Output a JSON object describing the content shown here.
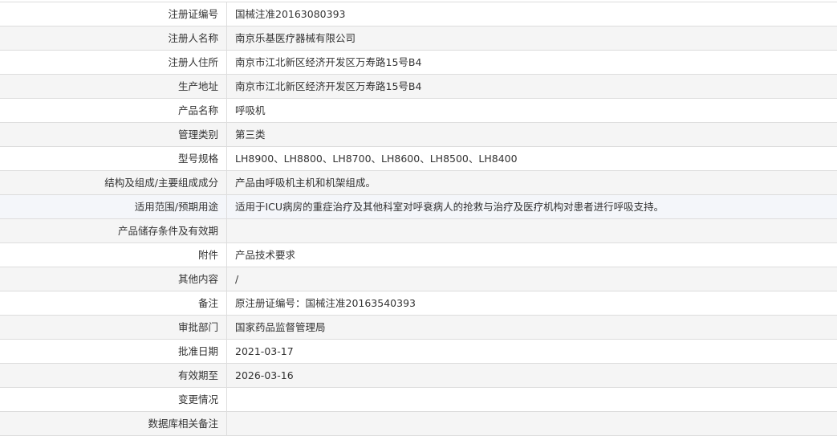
{
  "rows": [
    {
      "label": "注册证编号",
      "value": "国械注准20163080393"
    },
    {
      "label": "注册人名称",
      "value": "南京乐基医疗器械有限公司"
    },
    {
      "label": "注册人住所",
      "value": "南京市江北新区经济开发区万寿路15号B4"
    },
    {
      "label": "生产地址",
      "value": "南京市江北新区经济开发区万寿路15号B4"
    },
    {
      "label": "产品名称",
      "value": "呼吸机"
    },
    {
      "label": "管理类别",
      "value": "第三类"
    },
    {
      "label": "型号规格",
      "value": "LH8900、LH8800、LH8700、LH8600、LH8500、LH8400"
    },
    {
      "label": "结构及组成/主要组成成分",
      "value": "产品由呼吸机主机和机架组成。"
    },
    {
      "label": "适用范围/预期用途",
      "value": "适用于ICU病房的重症治疗及其他科室对呼衰病人的抢救与治疗及医疗机构对患者进行呼吸支持。"
    },
    {
      "label": "产品储存条件及有效期",
      "value": ""
    },
    {
      "label": "附件",
      "value": "产品技术要求"
    },
    {
      "label": "其他内容",
      "value": "/"
    },
    {
      "label": "备注",
      "value": "原注册证编号：国械注准20163540393"
    },
    {
      "label": "审批部门",
      "value": "国家药品监督管理局"
    },
    {
      "label": "批准日期",
      "value": "2021-03-17"
    },
    {
      "label": "有效期至",
      "value": "2026-03-16"
    },
    {
      "label": "变更情况",
      "value": ""
    },
    {
      "label": "数据库相关备注",
      "value": ""
    }
  ]
}
